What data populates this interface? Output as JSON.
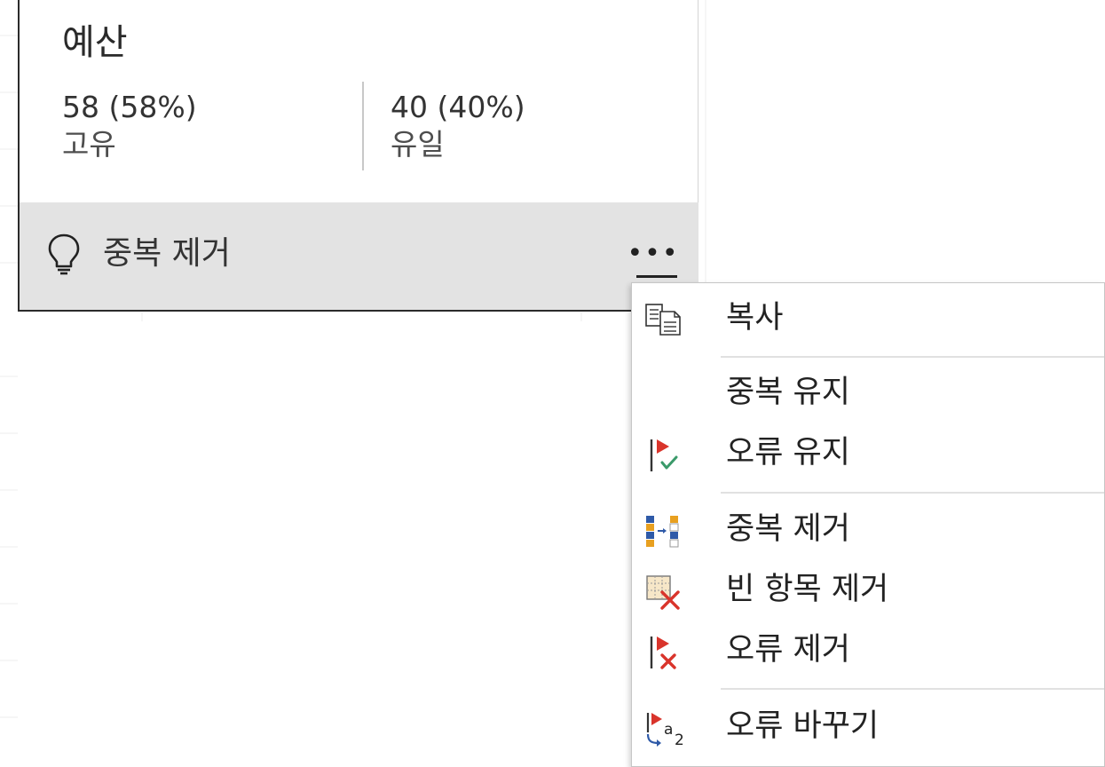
{
  "card": {
    "title": "예산",
    "unique": {
      "value": "58 (58%)",
      "label": "고유"
    },
    "single": {
      "value": "40 (40%)",
      "label": "유일"
    },
    "footer": {
      "action_label": "중복 제거",
      "more_label": "•••"
    }
  },
  "menu": {
    "items": [
      {
        "label": "복사",
        "icon": "copy-icon"
      },
      {
        "label": "중복 유지",
        "icon": ""
      },
      {
        "label": "오류 유지",
        "icon": "keep-errors-icon"
      },
      {
        "label": "중복 제거",
        "icon": "remove-duplicates-icon"
      },
      {
        "label": "빈 항목 제거",
        "icon": "remove-empty-icon"
      },
      {
        "label": "오류 제거",
        "icon": "remove-errors-icon"
      },
      {
        "label": "오류 바꾸기",
        "icon": "replace-errors-icon"
      }
    ]
  },
  "colors": {
    "footer_bg": "#e3e3e3",
    "flag_red": "#d9342b",
    "check_green": "#3a9a6a",
    "bar_blue": "#2f5aa8",
    "bar_orange": "#e8a020"
  }
}
